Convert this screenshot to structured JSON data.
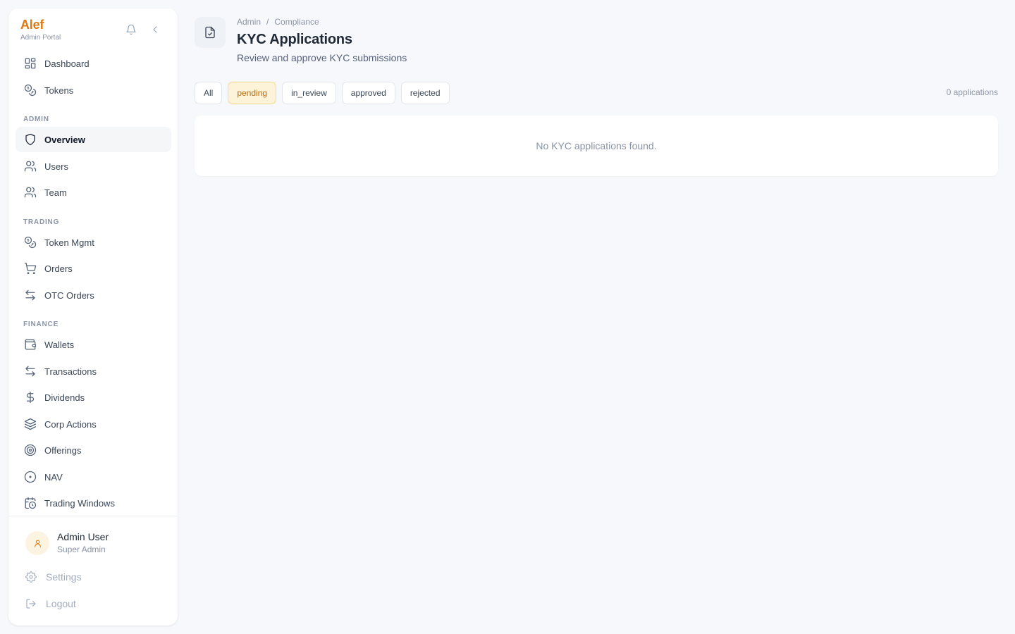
{
  "brand": {
    "name": "Alef",
    "subtitle": "Admin Portal",
    "accent_color": "#dd7a12"
  },
  "header_icons": [
    {
      "name": "bell-icon"
    },
    {
      "name": "chevron-left-icon"
    }
  ],
  "nav": {
    "main": [
      {
        "label": "Dashboard",
        "icon": "dashboard-icon"
      },
      {
        "label": "Tokens",
        "icon": "coins-icon"
      }
    ],
    "sections": [
      {
        "title": "ADMIN",
        "items": [
          {
            "label": "Overview",
            "icon": "shield-icon",
            "active": true
          },
          {
            "label": "Users",
            "icon": "users-icon"
          },
          {
            "label": "Team",
            "icon": "team-icon"
          }
        ]
      },
      {
        "title": "TRADING",
        "items": [
          {
            "label": "Token Mgmt",
            "icon": "coins-icon"
          },
          {
            "label": "Orders",
            "icon": "cart-icon"
          },
          {
            "label": "OTC Orders",
            "icon": "arrows-icon"
          }
        ]
      },
      {
        "title": "FINANCE",
        "items": [
          {
            "label": "Wallets",
            "icon": "wallet-icon"
          },
          {
            "label": "Transactions",
            "icon": "arrows-icon"
          },
          {
            "label": "Dividends",
            "icon": "dollar-icon"
          },
          {
            "label": "Corp Actions",
            "icon": "layers-icon"
          },
          {
            "label": "Offerings",
            "icon": "target-icon"
          },
          {
            "label": "NAV",
            "icon": "circle-dot-icon"
          },
          {
            "label": "Trading Windows",
            "icon": "calendar-clock-icon"
          }
        ]
      }
    ]
  },
  "user": {
    "name": "Admin User",
    "role": "Super Admin"
  },
  "footer": {
    "settings_label": "Settings",
    "logout_label": "Logout"
  },
  "page": {
    "icon": "file-check-icon",
    "breadcrumb": [
      "Admin",
      "Compliance"
    ],
    "breadcrumb_separator": "/",
    "title": "KYC Applications",
    "subtitle": "Review and approve KYC submissions"
  },
  "filters": [
    {
      "label": "All",
      "active": false
    },
    {
      "label": "pending",
      "active": true
    },
    {
      "label": "in_review",
      "active": false
    },
    {
      "label": "approved",
      "active": false
    },
    {
      "label": "rejected",
      "active": false
    }
  ],
  "count_text": "0 applications",
  "empty_message": "No KYC applications found."
}
